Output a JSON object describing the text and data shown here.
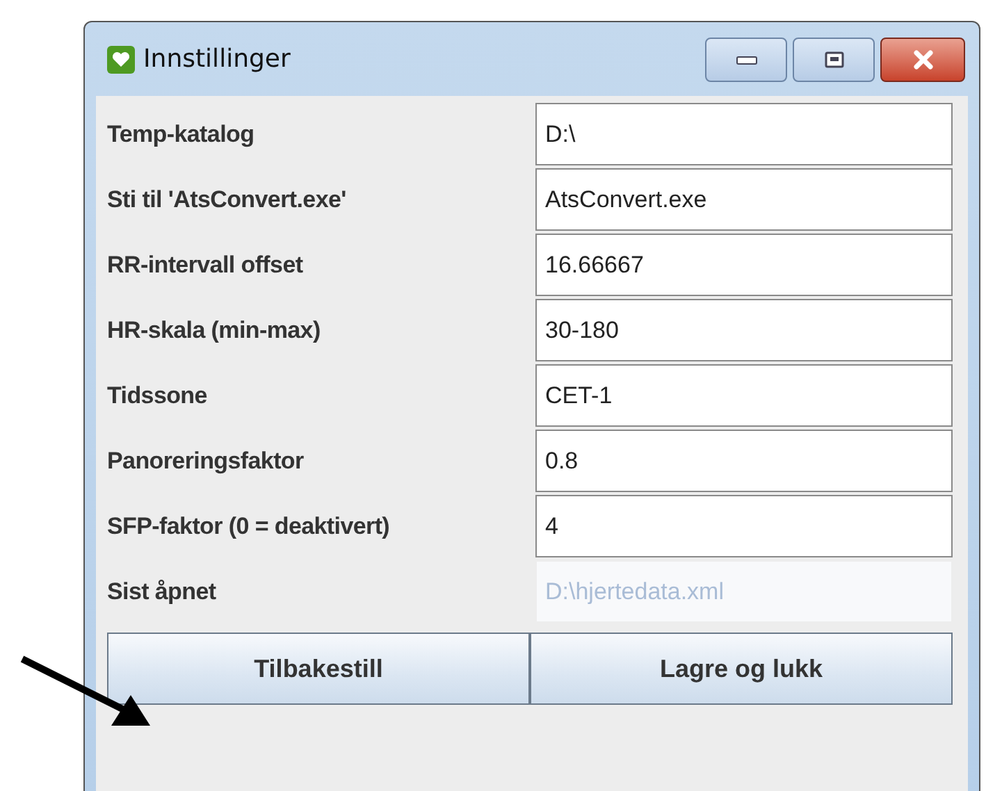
{
  "window": {
    "title": "Innstillinger"
  },
  "settings": [
    {
      "label": "Temp-katalog",
      "value": "D:\\",
      "disabled": false
    },
    {
      "label": "Sti til 'AtsConvert.exe'",
      "value": "AtsConvert.exe",
      "disabled": false
    },
    {
      "label": "RR-intervall offset",
      "value": "16.66667",
      "disabled": false
    },
    {
      "label": "HR-skala (min-max)",
      "value": "30-180",
      "disabled": false
    },
    {
      "label": "Tidssone",
      "value": "CET-1",
      "disabled": false
    },
    {
      "label": "Panoreringsfaktor",
      "value": "0.8",
      "disabled": false
    },
    {
      "label": "SFP-faktor (0 = deaktivert)",
      "value": "4",
      "disabled": false
    },
    {
      "label": "Sist åpnet",
      "value": "D:\\hjertedata.xml",
      "disabled": true
    }
  ],
  "buttons": [
    "Tilbakestill",
    "Lagre og lukk"
  ]
}
